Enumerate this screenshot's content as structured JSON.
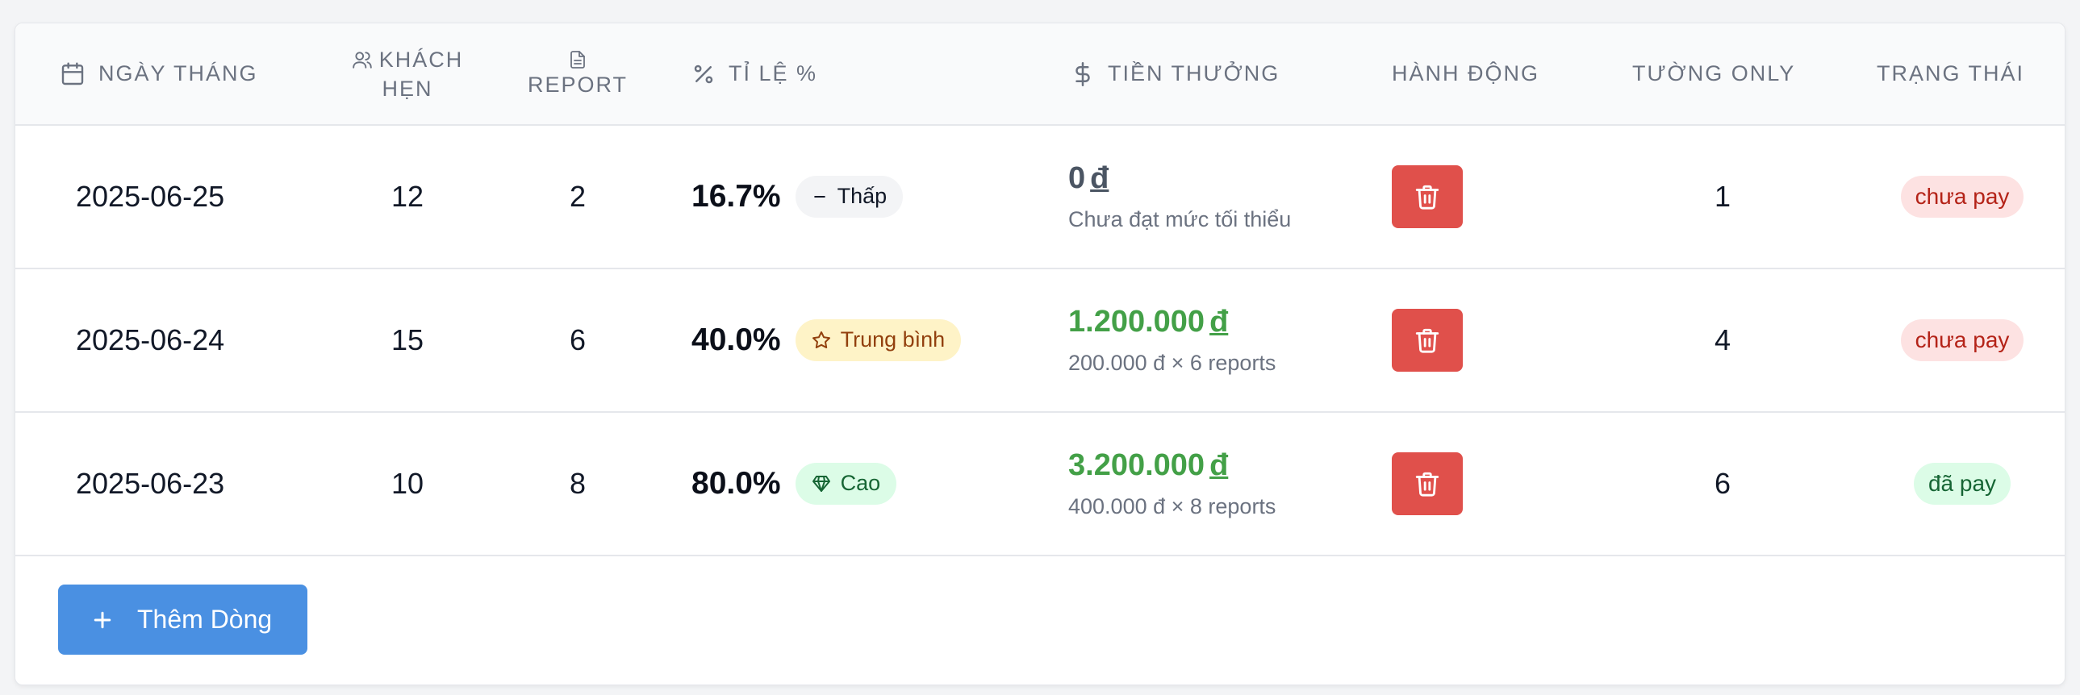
{
  "headers": {
    "date": "Ngày Tháng",
    "guests": "Khách",
    "guests_line2": "Hẹn",
    "report": "Report",
    "rate": "Tỉ Lệ %",
    "bonus": "Tiền Thưởng",
    "action": "Hành Động",
    "tuong_only": "Tường Only",
    "status": "Trạng Thái"
  },
  "rows": [
    {
      "date": "2025-06-25",
      "guests": "12",
      "reports": "2",
      "rate": "16.7%",
      "level": "Thấp",
      "bonus_amount": "0",
      "currency": "đ",
      "bonus_note": "Chưa đạt mức tối thiểu",
      "tuong_only": "1",
      "status": "chưa pay"
    },
    {
      "date": "2025-06-24",
      "guests": "15",
      "reports": "6",
      "rate": "40.0%",
      "level": "Trung bình",
      "bonus_amount": "1.200.000",
      "currency": "đ",
      "bonus_note": "200.000 đ × 6 reports",
      "tuong_only": "4",
      "status": "chưa pay"
    },
    {
      "date": "2025-06-23",
      "guests": "10",
      "reports": "8",
      "rate": "80.0%",
      "level": "Cao",
      "bonus_amount": "3.200.000",
      "currency": "đ",
      "bonus_note": "400.000 đ × 8 reports",
      "tuong_only": "6",
      "status": "đã pay"
    }
  ],
  "actions": {
    "add_row_label": "Thêm Dòng"
  },
  "icons": {
    "date": "calendar-icon",
    "guests": "users-icon",
    "report": "document-icon",
    "rate": "percent-icon",
    "bonus": "dollar-icon",
    "delete": "trash-icon",
    "level_low": "minus-icon",
    "level_medium": "star-icon",
    "level_high": "diamond-icon",
    "add": "plus-icon"
  },
  "colors": {
    "delete_button": "#e0504b",
    "add_button": "#4a90e2",
    "bonus_zero": "#4b5563",
    "bonus_positive": "#43a047",
    "badge_low_bg": "#f3f4f6",
    "badge_medium_bg": "#fef3c7",
    "badge_high_bg": "#dcfce7",
    "status_unpaid_bg": "#fde2e2",
    "status_unpaid_text": "#b42318",
    "status_paid_bg": "#dcfce7",
    "status_paid_text": "#166534"
  }
}
